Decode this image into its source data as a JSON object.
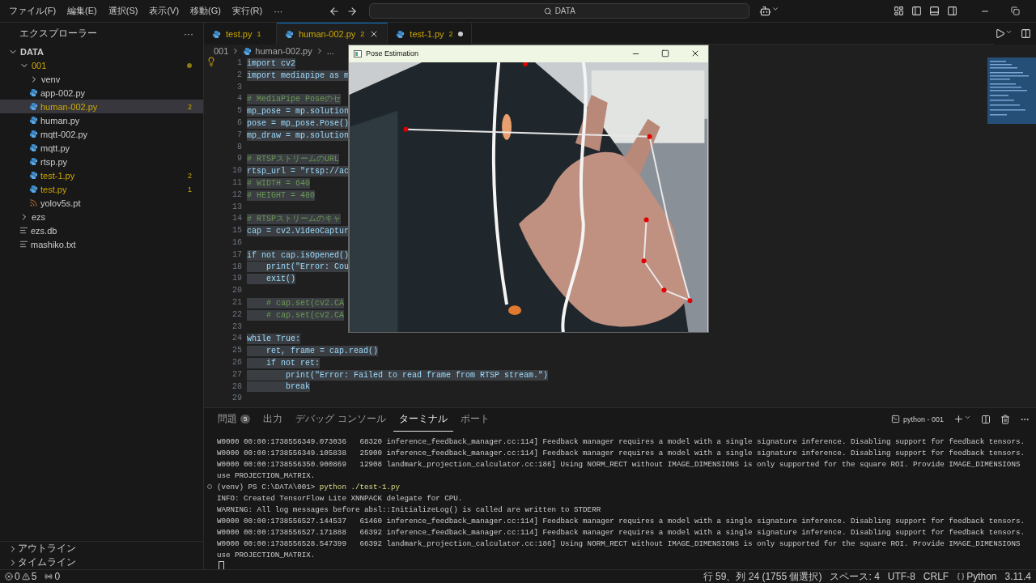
{
  "menu": [
    "ファイル(F)",
    "編集(E)",
    "選択(S)",
    "表示(V)",
    "移動(G)",
    "実行(R)",
    "···"
  ],
  "search": {
    "value": "DATA"
  },
  "sidebar": {
    "title": "エクスプローラー",
    "more": "···",
    "tree": [
      {
        "label": "DATA",
        "kind": "root",
        "expanded": true,
        "children": [
          {
            "label": "001",
            "kind": "folder",
            "expanded": true,
            "warning": true,
            "dot": true,
            "children": [
              {
                "label": "venv",
                "kind": "folder",
                "expanded": false,
                "warning": false
              },
              {
                "label": "app-002.py",
                "kind": "python",
                "warning": false,
                "selected": false
              },
              {
                "label": "human-002.py",
                "kind": "python",
                "warning": true,
                "selected": true,
                "badge": "2"
              },
              {
                "label": "human.py",
                "kind": "python",
                "warning": false,
                "selected": false
              },
              {
                "label": "mqtt-002.py",
                "kind": "python",
                "warning": false,
                "selected": false
              },
              {
                "label": "mqtt.py",
                "kind": "python",
                "warning": false,
                "selected": false
              },
              {
                "label": "rtsp.py",
                "kind": "python",
                "warning": false,
                "selected": false
              },
              {
                "label": "test-1.py",
                "kind": "python",
                "warning": true,
                "selected": false,
                "badge": "2"
              },
              {
                "label": "test.py",
                "kind": "python",
                "warning": true,
                "selected": false,
                "badge": "1"
              },
              {
                "label": "yolov5s.pt",
                "kind": "model",
                "warning": false,
                "selected": false
              }
            ]
          },
          {
            "label": "ezs",
            "kind": "folder",
            "expanded": false,
            "warning": false
          },
          {
            "label": "ezs.db",
            "kind": "file",
            "warning": false,
            "selected": false
          },
          {
            "label": "mashiko.txt",
            "kind": "file",
            "warning": false,
            "selected": false
          }
        ]
      }
    ],
    "sections": [
      {
        "label": "アウトライン",
        "expanded": false
      },
      {
        "label": "タイムライン",
        "expanded": false
      }
    ]
  },
  "tabs": [
    {
      "label": "test.py",
      "badge": "1",
      "selected": false,
      "modified": false
    },
    {
      "label": "human-002.py",
      "badge": "2",
      "selected": true,
      "modified": false
    },
    {
      "label": "test-1.py",
      "badge": "2",
      "selected": false,
      "modified": true
    }
  ],
  "breadcrumb": [
    "001",
    "human-002.py",
    "..."
  ],
  "code": [
    {
      "n": "1",
      "text": "import cv2",
      "kind": "code"
    },
    {
      "n": "2",
      "text": "import mediapipe as m",
      "kind": "code"
    },
    {
      "n": "3",
      "kind": "blank"
    },
    {
      "n": "4",
      "text": "# MediaPipe Poseのセ",
      "kind": "comment"
    },
    {
      "n": "5",
      "text": "mp_pose = mp.solution",
      "kind": "code"
    },
    {
      "n": "6",
      "text": "pose = mp_pose.Pose()",
      "kind": "code"
    },
    {
      "n": "7",
      "text": "mp_draw = mp.solution",
      "kind": "code"
    },
    {
      "n": "8",
      "kind": "blank"
    },
    {
      "n": "9",
      "text": "# RTSPストリームのURL",
      "kind": "comment"
    },
    {
      "n": "10",
      "text": "rtsp_url = \"rtsp://ac",
      "kind": "code"
    },
    {
      "n": "11",
      "text": "# WIDTH = 640",
      "kind": "comment"
    },
    {
      "n": "12",
      "text": "# HEIGHT = 480",
      "kind": "comment"
    },
    {
      "n": "13",
      "kind": "blank"
    },
    {
      "n": "14",
      "text": "# RTSPストリームのキャ",
      "kind": "comment"
    },
    {
      "n": "15",
      "text": "cap = cv2.VideoCaptur",
      "kind": "code"
    },
    {
      "n": "16",
      "kind": "blank"
    },
    {
      "n": "17",
      "text": "if not cap.isOpened()",
      "kind": "code"
    },
    {
      "n": "18",
      "text": "    print(\"Error: Cou",
      "kind": "code"
    },
    {
      "n": "19",
      "text": "    exit()",
      "kind": "code"
    },
    {
      "n": "20",
      "kind": "blank"
    },
    {
      "n": "21",
      "text": "    # cap.set(cv2.CA",
      "kind": "comment"
    },
    {
      "n": "22",
      "text": "    # cap.set(cv2.CA",
      "kind": "comment"
    },
    {
      "n": "23",
      "kind": "blank"
    },
    {
      "n": "24",
      "text": "while True:",
      "kind": "code"
    },
    {
      "n": "25",
      "text": "    ret, frame = cap.read()",
      "kind": "code"
    },
    {
      "n": "26",
      "text": "    if not ret:",
      "kind": "code"
    },
    {
      "n": "27",
      "text": "        print(\"Error: Failed to read frame from RTSP stream.\")",
      "kind": "code"
    },
    {
      "n": "28",
      "text": "        break",
      "kind": "code"
    },
    {
      "n": "29",
      "kind": "blank"
    }
  ],
  "pose_window": {
    "title": "Pose Estimation"
  },
  "panel": {
    "tabs": [
      {
        "label": "問題",
        "badge": "5",
        "selected": false
      },
      {
        "label": "出力",
        "selected": false
      },
      {
        "label": "デバッグ コンソール",
        "selected": false
      },
      {
        "label": "ターミナル",
        "selected": true
      },
      {
        "label": "ポート",
        "selected": false
      }
    ],
    "terminal_name": "python - 001",
    "lines": [
      {
        "kind": "log",
        "text": "W0000 00:00:1738556349.073036   68320 inference_feedback_manager.cc:114] Feedback manager requires a model with a single signature inference. Disabling support for feedback tensors."
      },
      {
        "kind": "log",
        "text": "W0000 00:00:1738556349.105838   25900 inference_feedback_manager.cc:114] Feedback manager requires a model with a single signature inference. Disabling support for feedback tensors."
      },
      {
        "kind": "log",
        "text": "W0000 00:00:1738556350.900869   12908 landmark_projection_calculator.cc:186] Using NORM_RECT without IMAGE_DIMENSIONS is only supported for the square ROI. Provide IMAGE_DIMENSIONS"
      },
      {
        "kind": "log",
        "text": "use PROJECTION_MATRIX."
      },
      {
        "kind": "prompt",
        "prompt": "(venv) PS C:\\DATA\\001>",
        "command": "python ./test-1.py"
      },
      {
        "kind": "log",
        "text": "INFO: Created TensorFlow Lite XNNPACK delegate for CPU."
      },
      {
        "kind": "log",
        "text": "WARNING: All log messages before absl::InitializeLog() is called are written to STDERR"
      },
      {
        "kind": "log",
        "text": "W0000 00:00:1738556527.144537   61460 inference_feedback_manager.cc:114] Feedback manager requires a model with a single signature inference. Disabling support for feedback tensors."
      },
      {
        "kind": "log",
        "text": "W0000 00:00:1738556527.171888   66392 inference_feedback_manager.cc:114] Feedback manager requires a model with a single signature inference. Disabling support for feedback tensors."
      },
      {
        "kind": "log",
        "text": "W0000 00:00:1738556528.547399   66392 landmark_projection_calculator.cc:186] Using NORM_RECT without IMAGE_DIMENSIONS is only supported for the square ROI. Provide IMAGE_DIMENSIONS"
      },
      {
        "kind": "log",
        "text": "use PROJECTION_MATRIX."
      },
      {
        "kind": "cursor"
      }
    ]
  },
  "status_bar": {
    "errors": "0",
    "warnings": "5",
    "ports": "0",
    "position": "行 59、列 24 (1755 個選択)",
    "indent": "スペース: 4",
    "encoding": "UTF-8",
    "eol": "CRLF",
    "language": "Python",
    "version": "3.11.4"
  }
}
